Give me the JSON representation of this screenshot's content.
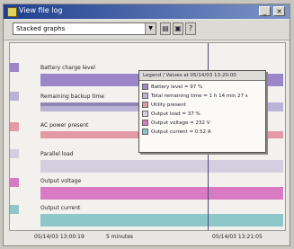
{
  "window": {
    "title": "View file log"
  },
  "toolbar": {
    "graph_select": "Stacked graphs"
  },
  "lanes": [
    {
      "label": "Battery charge level",
      "color": "#9a86c8"
    },
    {
      "label": "Remaining backup time",
      "color": "#b9b3d6"
    },
    {
      "label": "AC power present",
      "color": "#e39aa6"
    },
    {
      "label": "Parallel load",
      "color": "#d3cfe0"
    },
    {
      "label": "Output voltage",
      "color": "#d97ac4"
    },
    {
      "label": "Output current",
      "color": "#8ec7c9"
    }
  ],
  "legend_popup": {
    "header": "Legend / Values at 05/14/03 13:20:00",
    "items": [
      {
        "text": "Battery level = 97 %",
        "color": "#9a86c8"
      },
      {
        "text": "Total remaining time = 1 h 14 min 27 s",
        "color": "#b9b3d6"
      },
      {
        "text": "Utility present",
        "color": "#e39aa6"
      },
      {
        "text": "Output load = 37 %",
        "color": "#d3cfe0"
      },
      {
        "text": "Output voltage = 232 V",
        "color": "#d97ac4"
      },
      {
        "text": "Output current = 0.52 A",
        "color": "#8ec7c9"
      }
    ]
  },
  "time_axis": {
    "start": "05/14/03 13:00:19",
    "span": "5 minutes",
    "end": "05/14/03 13:21:05"
  }
}
